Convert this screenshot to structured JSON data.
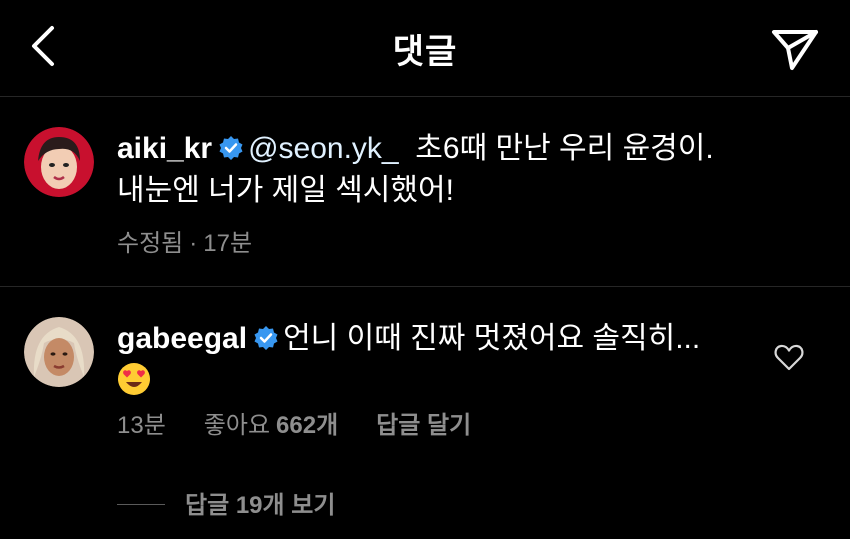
{
  "header": {
    "title": "댓글"
  },
  "caption": {
    "username": "aiki_kr",
    "mention": "@seon.yk_",
    "text_line1": "초6때 만난 우리 윤경이.",
    "text_line2": "내눈엔 너가 제일 섹시했어!",
    "edited_label": "수정됨",
    "separator": "·",
    "time": "17분"
  },
  "comment": {
    "username": "gabeegal",
    "text": "언니 이때 진짜 멋졌어요 솔직히...",
    "emoji": "heart-eyes-emoji",
    "time": "13분",
    "likes_label": "좋아요",
    "likes_count": "662개",
    "reply_label": "답글 달기",
    "view_replies": "답글 19개 보기"
  },
  "colors": {
    "background": "#000000",
    "text": "#ffffff",
    "secondary_text": "#8e8e8e",
    "verified_badge": "#3897f0",
    "divider": "#262626"
  }
}
